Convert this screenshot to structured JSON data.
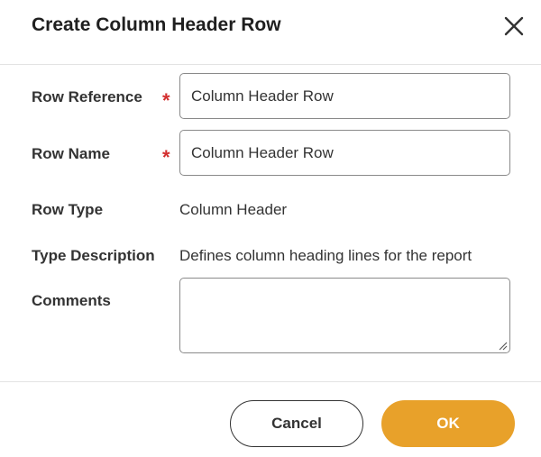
{
  "dialog": {
    "title": "Create Column Header Row",
    "close_icon": "close-icon"
  },
  "form": {
    "row_reference": {
      "label": "Row Reference",
      "required_marker": "*",
      "value": "Column Header Row"
    },
    "row_name": {
      "label": "Row Name",
      "required_marker": "*",
      "value": "Column Header Row"
    },
    "row_type": {
      "label": "Row Type",
      "value": "Column Header"
    },
    "type_description": {
      "label": "Type Description",
      "value": "Defines column heading lines for the report"
    },
    "comments": {
      "label": "Comments",
      "value": ""
    }
  },
  "footer": {
    "cancel_label": "Cancel",
    "ok_label": "OK"
  },
  "colors": {
    "required": "#d32f2f",
    "ok_button": "#e8a12a",
    "text": "#333333"
  }
}
